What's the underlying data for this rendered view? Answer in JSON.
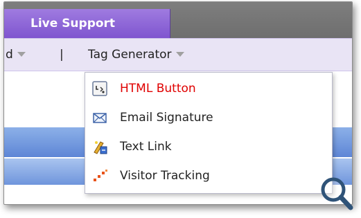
{
  "tabs": {
    "live_support": "Live Support"
  },
  "menubar": {
    "prev_item": "d",
    "separator": "|",
    "tag_generator": "Tag Generator"
  },
  "dropdown": {
    "items": [
      {
        "label": "HTML Button",
        "icon": "html-button-icon",
        "active": true
      },
      {
        "label": "Email Signature",
        "icon": "envelope-icon",
        "active": false
      },
      {
        "label": "Text Link",
        "icon": "text-link-icon",
        "active": false
      },
      {
        "label": "Visitor Tracking",
        "icon": "visitor-tracking-icon",
        "active": false
      }
    ]
  },
  "colors": {
    "tab_purple": "#8a62d6",
    "menubar_bg": "#e9e4f5",
    "active_text": "#e00000",
    "stripe_blue": "#6f95dc"
  }
}
